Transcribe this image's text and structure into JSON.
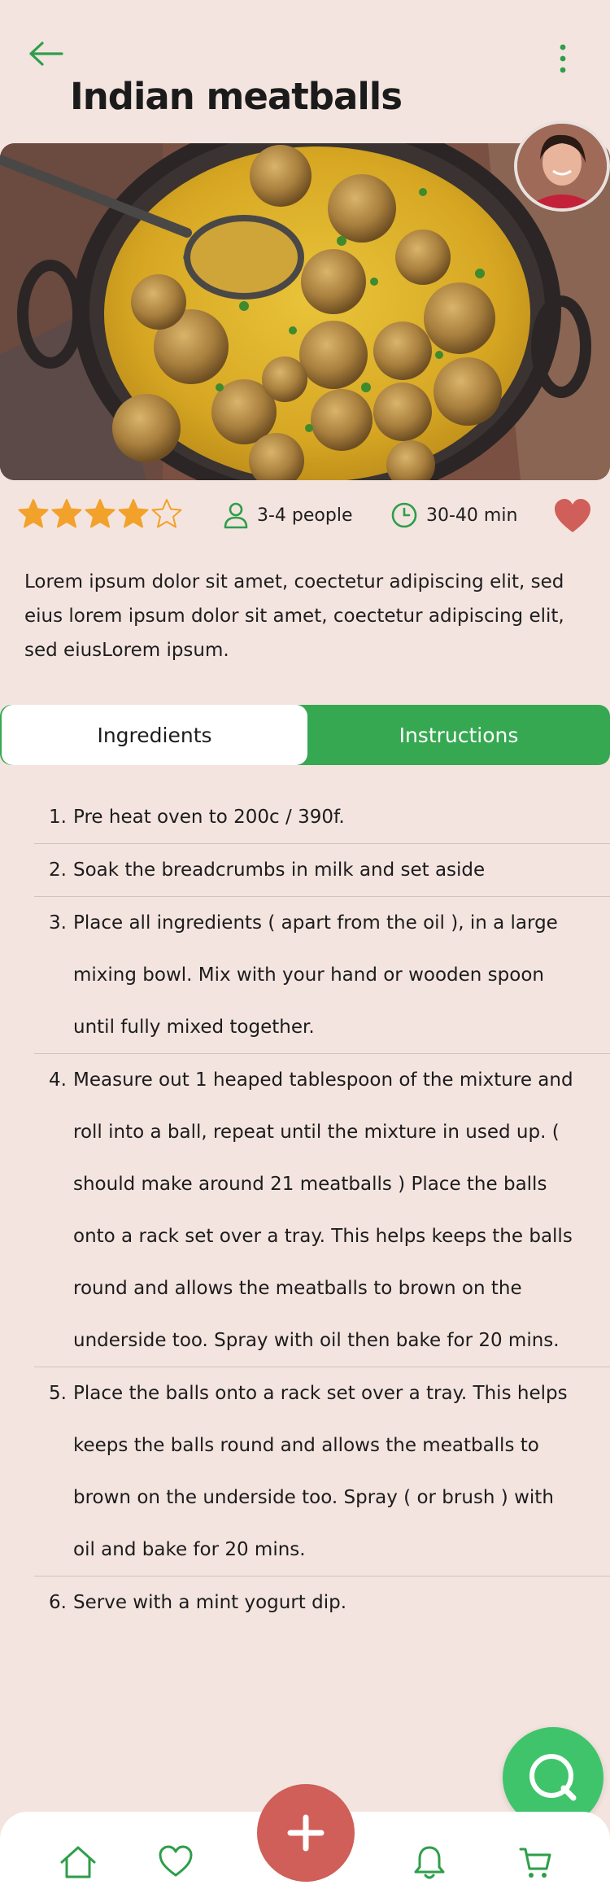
{
  "header": {
    "back_icon": "arrow-left-icon",
    "more_icon": "more-vertical-icon",
    "title": "Indian meatballs"
  },
  "recipe": {
    "image_icon": "meatball-dish-image",
    "author_avatar": "author-avatar",
    "rating": 4,
    "rating_max": 5,
    "servings": "3-4 people",
    "duration": "30-40 min",
    "favorite": true,
    "description": "Lorem ipsum dolor sit amet, coectetur adipiscing elit, sed eius lorem ipsum dolor sit amet, coectetur adipiscing elit, sed eiusLorem ipsum."
  },
  "tabs": {
    "ingredients": "Ingredients",
    "instructions": "Instructions",
    "active": "instructions"
  },
  "steps": [
    {
      "num": "1.",
      "text": "Pre heat oven to 200c / 390f."
    },
    {
      "num": "2.",
      "text": "Soak the breadcrumbs in milk and set aside"
    },
    {
      "num": "3.",
      "text": "Place all ingredients ( apart from the oil ), in a large mixing bowl. Mix with your hand or wooden spoon until fully mixed together."
    },
    {
      "num": "4.",
      "text": "Measure out 1 heaped tablespoon of the mixture and roll into a ball, repeat until the mixture in used up. ( should make around 21 meatballs ) Place the balls onto a rack set over a tray. This helps keeps the balls round and allows the meatballs to brown on the underside too. Spray with oil then bake for 20 mins."
    },
    {
      "num": "5.",
      "text": "Place the balls onto a rack set over a tray. This helps keeps the balls round and allows the meatballs to brown on the underside too. Spray ( or brush ) with oil and bake for 20 mins."
    },
    {
      "num": "6.",
      "text": "Serve with a mint yogurt dip."
    }
  ],
  "nav": {
    "items": [
      "home-icon",
      "heart-icon",
      "bell-icon",
      "cart-icon"
    ],
    "add_icon": "plus-icon",
    "chat_icon": "chat-bubble-icon"
  },
  "colors": {
    "background": "#f4e4df",
    "accent_green": "#36a852",
    "accent_red": "#cf5f58",
    "star": "#f2a12a"
  }
}
